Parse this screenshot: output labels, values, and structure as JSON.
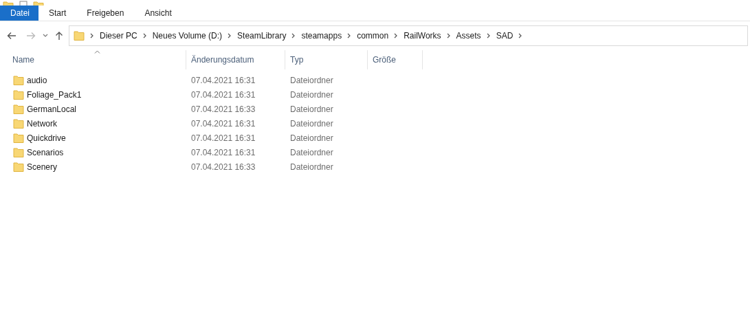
{
  "ribbon_tabs": [
    {
      "label": "Datei",
      "selected": true
    },
    {
      "label": "Start",
      "selected": false
    },
    {
      "label": "Freigeben",
      "selected": false
    },
    {
      "label": "Ansicht",
      "selected": false
    }
  ],
  "breadcrumb": [
    "Dieser PC",
    "Neues Volume (D:)",
    "SteamLibrary",
    "steamapps",
    "common",
    "RailWorks",
    "Assets",
    "SAD"
  ],
  "table": {
    "columns": [
      "Name",
      "Änderungsdatum",
      "Typ",
      "Größe"
    ],
    "rows": [
      {
        "name": "audio",
        "modified": "07.04.2021 16:31",
        "type": "Dateiordner"
      },
      {
        "name": "Foliage_Pack1",
        "modified": "07.04.2021 16:31",
        "type": "Dateiordner"
      },
      {
        "name": "GermanLocal",
        "modified": "07.04.2021 16:33",
        "type": "Dateiordner"
      },
      {
        "name": "Network",
        "modified": "07.04.2021 16:31",
        "type": "Dateiordner"
      },
      {
        "name": "Quickdrive",
        "modified": "07.04.2021 16:31",
        "type": "Dateiordner"
      },
      {
        "name": "Scenarios",
        "modified": "07.04.2021 16:31",
        "type": "Dateiordner"
      },
      {
        "name": "Scenery",
        "modified": "07.04.2021 16:33",
        "type": "Dateiordner"
      }
    ]
  }
}
